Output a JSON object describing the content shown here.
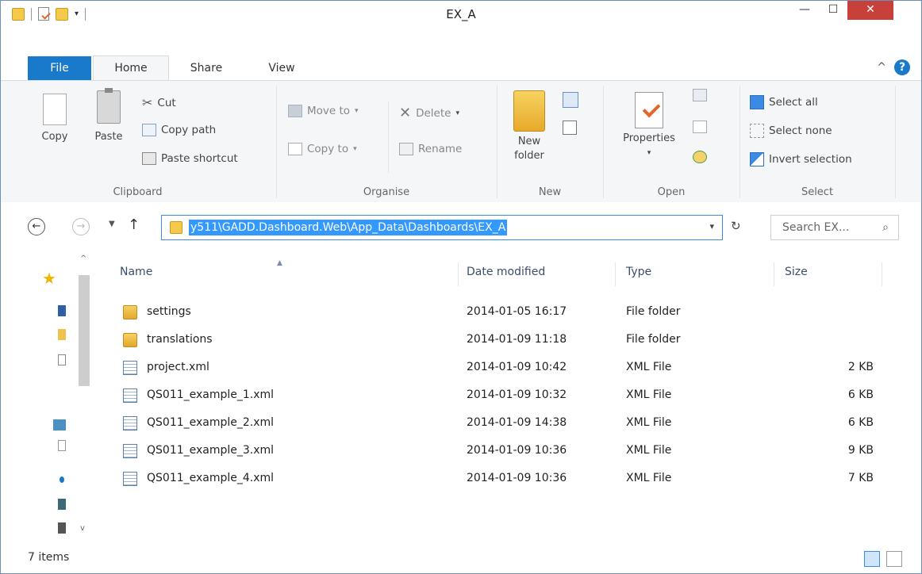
{
  "window": {
    "title": "EX_A",
    "minimize": "—",
    "maximize": "☐",
    "close": "✕"
  },
  "ribbon_tabs": {
    "file": "File",
    "home": "Home",
    "share": "Share",
    "view": "View",
    "collapse": "^",
    "help": "?"
  },
  "clipboard": {
    "copy": "Copy",
    "paste": "Paste",
    "cut": "Cut",
    "copy_path": "Copy path",
    "paste_shortcut": "Paste shortcut",
    "label": "Clipboard"
  },
  "organise": {
    "move_to": "Move to",
    "copy_to": "Copy to",
    "delete": "Delete",
    "rename": "Rename",
    "label": "Organise"
  },
  "new_group": {
    "new_folder_line1": "New",
    "new_folder_line2": "folder",
    "label": "New"
  },
  "open_group": {
    "properties": "Properties",
    "label": "Open"
  },
  "select_group": {
    "select_all": "Select all",
    "select_none": "Select none",
    "invert_selection": "Invert selection",
    "label": "Select"
  },
  "address": {
    "path": "y511\\GADD.Dashboard.Web\\App_Data\\Dashboards\\EX_A",
    "search_placeholder": "Search EX..."
  },
  "columns": {
    "name": "Name",
    "date_modified": "Date modified",
    "type": "Type",
    "size": "Size"
  },
  "files": [
    {
      "name": "settings",
      "date": "2014-01-05 16:17",
      "type": "File folder",
      "size": "",
      "kind": "folder"
    },
    {
      "name": "translations",
      "date": "2014-01-09 11:18",
      "type": "File folder",
      "size": "",
      "kind": "folder"
    },
    {
      "name": "project.xml",
      "date": "2014-01-09 10:42",
      "type": "XML File",
      "size": "2 KB",
      "kind": "xml"
    },
    {
      "name": "QS011_example_1.xml",
      "date": "2014-01-09 10:32",
      "type": "XML File",
      "size": "6 KB",
      "kind": "xml"
    },
    {
      "name": "QS011_example_2.xml",
      "date": "2014-01-09 14:38",
      "type": "XML File",
      "size": "6 KB",
      "kind": "xml"
    },
    {
      "name": "QS011_example_3.xml",
      "date": "2014-01-09 10:36",
      "type": "XML File",
      "size": "9 KB",
      "kind": "xml"
    },
    {
      "name": "QS011_example_4.xml",
      "date": "2014-01-09 10:36",
      "type": "XML File",
      "size": "7 KB",
      "kind": "xml"
    }
  ],
  "status": {
    "items": "7 items"
  },
  "colors": {
    "accent": "#1979ca",
    "selection": "#3399ff",
    "close": "#c7403a",
    "folder": "#f0c24b"
  }
}
